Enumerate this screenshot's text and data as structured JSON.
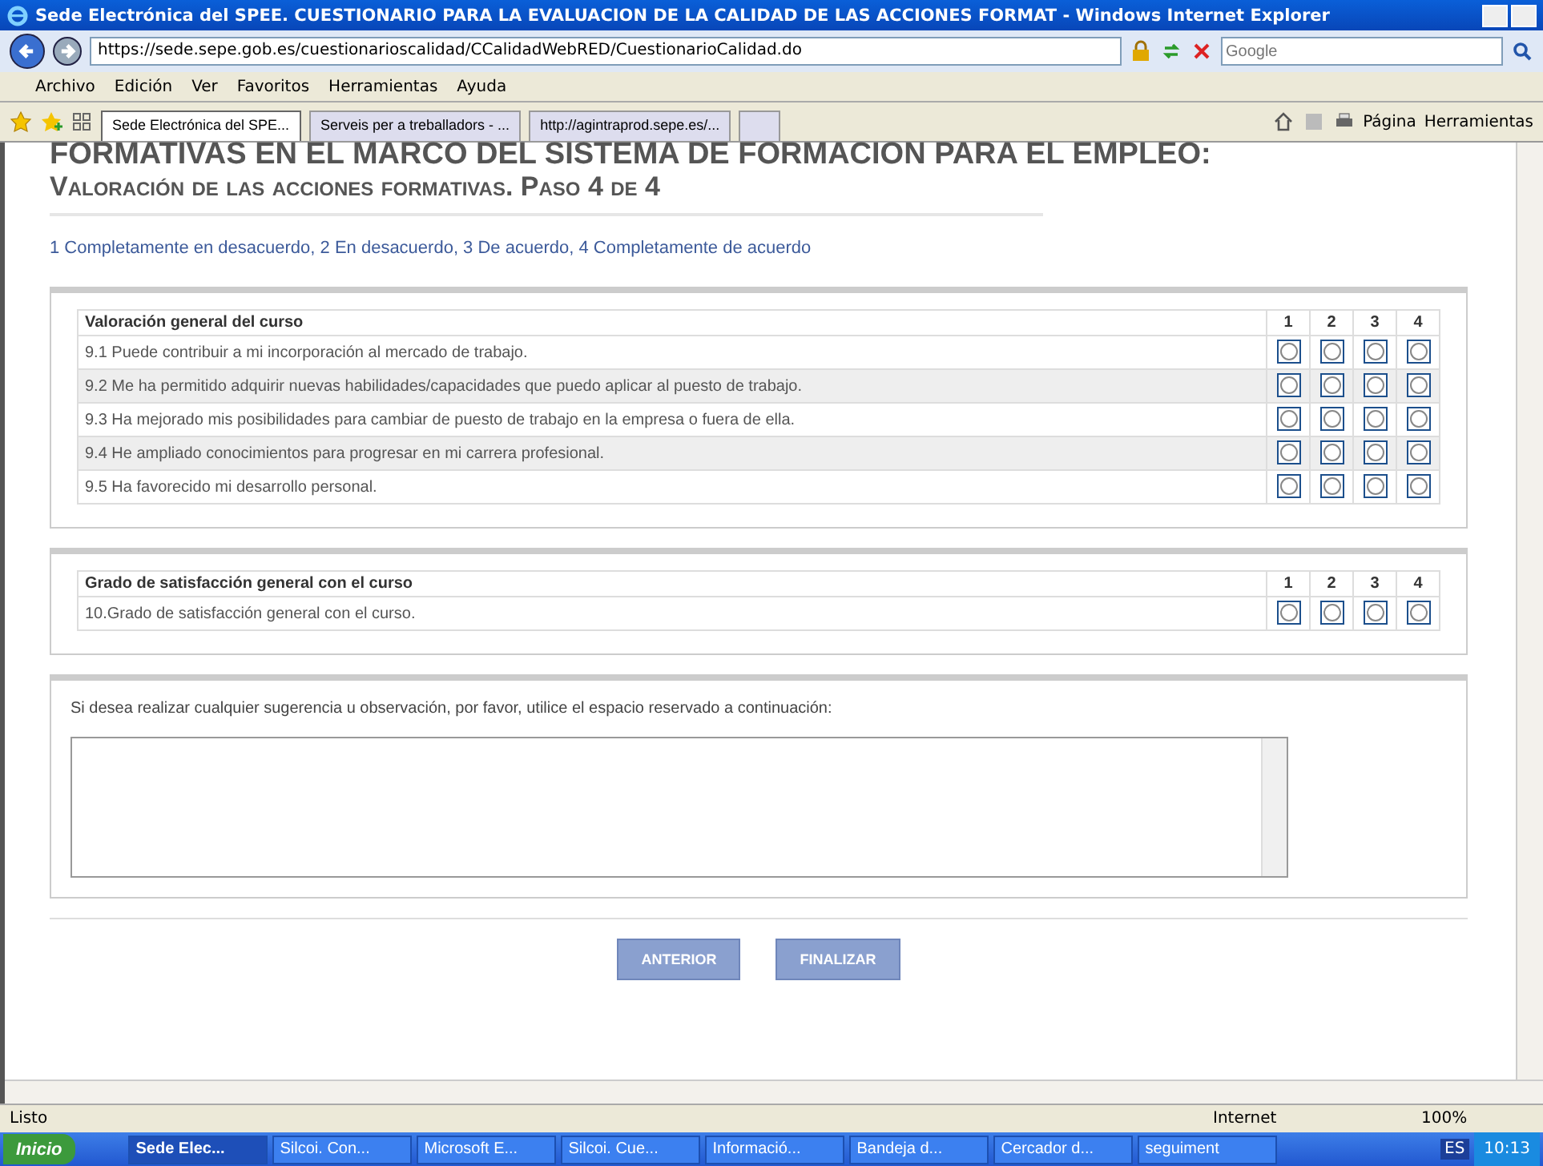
{
  "window": {
    "title": "Sede Electrónica del SPEE. CUESTIONARIO PARA LA EVALUACION DE LA CALIDAD DE LAS ACCIONES FORMAT - Windows Internet Explorer"
  },
  "address_bar": {
    "url": "https://sede.sepe.gob.es/cuestionarioscalidad/CCalidadWebRED/CuestionarioCalidad.do",
    "search_placeholder": "Google"
  },
  "menu": [
    "Archivo",
    "Edición",
    "Ver",
    "Favoritos",
    "Herramientas",
    "Ayuda"
  ],
  "tabs": [
    {
      "label": "Sede Electrónica del SPE...",
      "selected": true
    },
    {
      "label": "Serveis per a treballadors - ...",
      "selected": false
    },
    {
      "label": "http://agintraprod.sepe.es/...",
      "selected": false
    }
  ],
  "command_bar": [
    "Página",
    "Herramientas"
  ],
  "page": {
    "heading": [
      "FORMATIVAS EN EL MARCO DEL SISTEMA DE FORMACION PARA EL EMPLEO:",
      "Valoración de las acciones formativas. Paso 4 de 4"
    ],
    "legend": "1 Completamente en desacuerdo, 2 En desacuerdo, 3 De acuerdo, 4 Completamente de acuerdo",
    "sections": [
      {
        "heading": "Valoración general del curso",
        "scale": [
          "1",
          "2",
          "3",
          "4"
        ],
        "questions": [
          {
            "text": "9.1 Puede contribuir a mi incorporación al mercado de trabajo.",
            "options": [
              {
                "selected": false
              },
              {
                "selected": false
              },
              {
                "selected": false
              },
              {
                "selected": false
              }
            ]
          },
          {
            "text": "9.2 Me ha permitido adquirir nuevas habilidades/capacidades que puedo aplicar al puesto de trabajo.",
            "options": [
              {
                "selected": false
              },
              {
                "selected": false
              },
              {
                "selected": false
              },
              {
                "selected": false
              }
            ]
          },
          {
            "text": "9.3 Ha mejorado mis posibilidades para cambiar de puesto de trabajo en la empresa o fuera de ella.",
            "options": [
              {
                "selected": false
              },
              {
                "selected": false
              },
              {
                "selected": false
              },
              {
                "selected": false
              }
            ]
          },
          {
            "text": "9.4 He ampliado conocimientos para progresar en mi carrera profesional.",
            "options": [
              {
                "selected": false
              },
              {
                "selected": false
              },
              {
                "selected": false
              },
              {
                "selected": false
              }
            ]
          },
          {
            "text": "9.5 Ha favorecido mi desarrollo personal.",
            "options": [
              {
                "selected": false
              },
              {
                "selected": false
              },
              {
                "selected": false
              },
              {
                "selected": false
              }
            ]
          }
        ]
      },
      {
        "heading": "Grado de satisfacción general con el curso",
        "scale": [
          "1",
          "2",
          "3",
          "4"
        ],
        "questions": [
          {
            "text": "10.Grado de satisfacción general con el curso.",
            "options": [
              {
                "selected": false
              },
              {
                "selected": false
              },
              {
                "selected": false
              },
              {
                "selected": false
              }
            ]
          }
        ]
      }
    ],
    "comments_label": "Si desea realizar cualquier sugerencia u observación, por favor, utilice el espacio reservado a continuación:",
    "buttons": [
      "ANTERIOR",
      "FINALIZAR"
    ]
  },
  "status_bar": {
    "text": "Listo",
    "zone": "Internet",
    "zoom": "100%"
  },
  "taskbar": {
    "start": "Inicio",
    "tasks": [
      {
        "label": "Sede Elec...",
        "selected": true
      },
      {
        "label": "Silcoi. Con...",
        "selected": false
      },
      {
        "label": "Microsoft E...",
        "selected": false
      },
      {
        "label": "Silcoi. Cue...",
        "selected": false
      },
      {
        "label": "Informació...",
        "selected": false
      },
      {
        "label": "Bandeja d...",
        "selected": false
      },
      {
        "label": "Cercador d...",
        "selected": false
      },
      {
        "label": "seguiment",
        "selected": false
      }
    ],
    "language": "ES",
    "clock": "10:13"
  }
}
